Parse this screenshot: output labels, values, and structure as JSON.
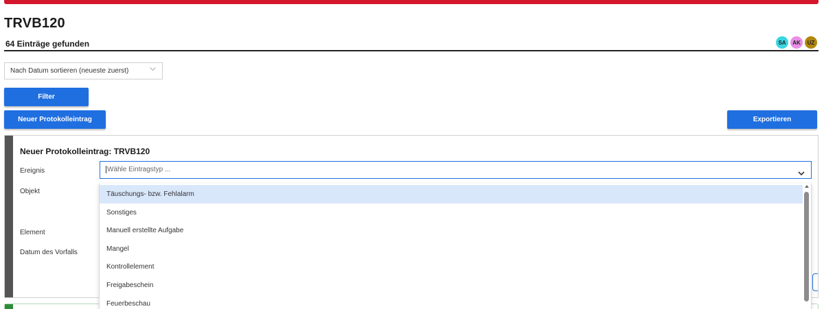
{
  "header": {
    "title": "TRVB120",
    "entry_count": "64 Einträge gefunden",
    "avatars": [
      {
        "initials": "SA",
        "color": "#39d6e0"
      },
      {
        "initials": "AK",
        "color": "#e98fe6"
      },
      {
        "initials": "UZ",
        "color": "#b0860e"
      }
    ]
  },
  "toolbar": {
    "sort_label": "Nach Datum sortieren (neueste zuerst)",
    "filter_label": "Filter",
    "new_entry_label": "Neuer Protokolleintrag",
    "export_label": "Exportieren"
  },
  "form": {
    "title": "Neuer Protokolleintrag: TRVB120",
    "labels": {
      "ereignis": "Ereignis",
      "objekt": "Objekt",
      "element": "Element",
      "datum": "Datum des Vorfalls"
    },
    "event_placeholder": "Wähle Eintragstyp ...",
    "event_options": [
      "Täuschungs- bzw. Fehlalarm",
      "Sonstiges",
      "Manuell erstellte Aufgabe",
      "Mangel",
      "Kontrollelement",
      "Freigabeschein",
      "Feuerbeschau"
    ],
    "highlighted_option": "Täuschungs- bzw. Fehlalarm"
  },
  "colors": {
    "top_bar": "#d3162b",
    "primary_button": "#1f6fe0",
    "panel_stripe": "#555555",
    "option_highlight": "#d9e7fb",
    "success_accent": "#2e8b3a"
  }
}
